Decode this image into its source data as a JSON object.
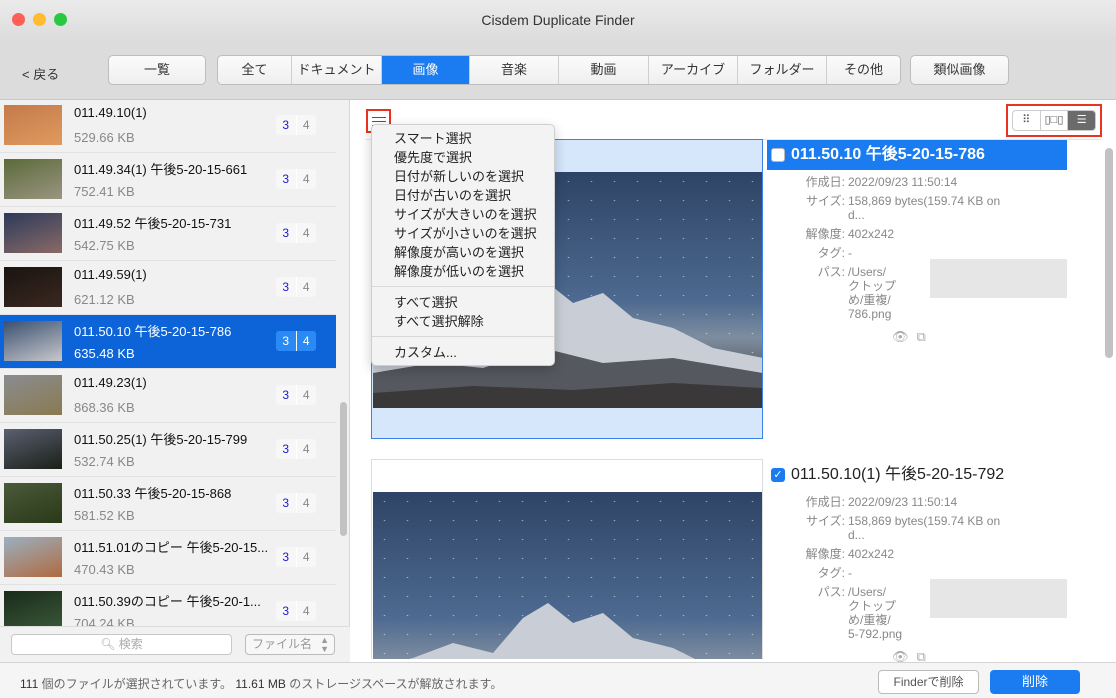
{
  "window": {
    "title": "Cisdem Duplicate Finder"
  },
  "toolbar": {
    "back_label": "< 戻る",
    "overview_label": "一覧",
    "tabs": [
      {
        "label": "全て",
        "active": false
      },
      {
        "label": "ドキュメント",
        "active": false
      },
      {
        "label": "画像",
        "active": true
      },
      {
        "label": "音楽",
        "active": false
      },
      {
        "label": "動画",
        "active": false
      },
      {
        "label": "アーカイブ",
        "active": false
      },
      {
        "label": "フォルダー",
        "active": false
      },
      {
        "label": "その他",
        "active": false
      }
    ],
    "similar_label": "類似画像"
  },
  "sidebar": {
    "items": [
      {
        "name": "011.49.10(1)",
        "size": "529.66 KB",
        "a": "3",
        "b": "4",
        "thumb": [
          "#c47a4a",
          "#e09a5e"
        ]
      },
      {
        "name": "011.49.34(1) 午後5-20-15-661",
        "size": "752.41 KB",
        "a": "3",
        "b": "4",
        "thumb": [
          "#5b6a3a",
          "#9a9580"
        ]
      },
      {
        "name": "011.49.52 午後5-20-15-731",
        "size": "542.75 KB",
        "a": "3",
        "b": "4",
        "thumb": [
          "#2c3a5a",
          "#8a6a66"
        ]
      },
      {
        "name": "011.49.59(1)",
        "size": "621.12 KB",
        "a": "3",
        "b": "4",
        "thumb": [
          "#1a1410",
          "#3a2820"
        ]
      },
      {
        "name": "011.50.10 午後5-20-15-786",
        "size": "635.48 KB",
        "a": "3",
        "b": "4",
        "thumb": [
          "#3a5070",
          "#c8c8cc"
        ],
        "selected": true
      },
      {
        "name": "011.49.23(1)",
        "size": "868.36 KB",
        "a": "3",
        "b": "4",
        "thumb": [
          "#8a8c90",
          "#8a7a50"
        ]
      },
      {
        "name": "011.50.25(1) 午後5-20-15-799",
        "size": "532.74 KB",
        "a": "3",
        "b": "4",
        "thumb": [
          "#5a6070",
          "#1a2018"
        ]
      },
      {
        "name": "011.50.33 午後5-20-15-868",
        "size": "581.52 KB",
        "a": "3",
        "b": "4",
        "thumb": [
          "#4a5a3a",
          "#2a3a18"
        ]
      },
      {
        "name": "011.51.01のコピー 午後5-20-15...",
        "size": "470.43 KB",
        "a": "3",
        "b": "4",
        "thumb": [
          "#9ab0c0",
          "#b06a40"
        ]
      },
      {
        "name": "011.50.39のコピー 午後5-20-1...",
        "size": "704.24 KB",
        "a": "3",
        "b": "4",
        "thumb": [
          "#1a2a1a",
          "#3a5a3a"
        ]
      }
    ],
    "search_placeholder": "検索",
    "search_icon": "magnifier-icon",
    "sort_label": "ファイル名"
  },
  "view_modes": [
    {
      "icon": "grid-view-icon",
      "glyph": "⠿",
      "active": false
    },
    {
      "icon": "filmstrip-view-icon",
      "glyph": "▯□▯",
      "active": false
    },
    {
      "icon": "list-view-icon",
      "glyph": "☰",
      "active": true
    }
  ],
  "select_menu": {
    "items": [
      "スマート選択",
      "優先度で選択",
      "日付が新しいのを選択",
      "日付が古いのを選択",
      "サイズが大きいのを選択",
      "サイズが小さいのを選択",
      "解像度が高いのを選択",
      "解像度が低いのを選択"
    ],
    "items2": [
      "すべて選択",
      "すべて選択解除"
    ],
    "items3": [
      "カスタム..."
    ]
  },
  "files": [
    {
      "title": "011.50.10 午後5-20-15-786",
      "checked": false,
      "selected": true,
      "created_label": "作成日:",
      "created": "2022/09/23 11:50:14",
      "size_label": "サイズ:",
      "size": "158,869 bytes(159.74 KB on d...",
      "res_label": "解像度:",
      "res": "402x242",
      "tag_label": "タグ:",
      "tag": "-",
      "path_label": "パス:",
      "path": [
        "/Users/",
        "クトップ",
        "め/重複/",
        "786.png"
      ]
    },
    {
      "title": "011.50.10(1) 午後5-20-15-792",
      "checked": true,
      "selected": false,
      "created_label": "作成日:",
      "created": "2022/09/23 11:50:14",
      "size_label": "サイズ:",
      "size": "158,869 bytes(159.74 KB on d...",
      "res_label": "解像度:",
      "res": "402x242",
      "tag_label": "タグ:",
      "tag": "-",
      "path_label": "パス:",
      "path": [
        "/Users/",
        "クトップ",
        "め/重複/",
        "5-792.png"
      ]
    }
  ],
  "status": {
    "count": "111",
    "count_text": " 個のファイルが選択されています。 ",
    "size": "11.61 MB",
    "size_text": " のストレージスペースが解放されます。"
  },
  "actions": {
    "finder_delete": "Finderで削除",
    "delete": "削除"
  },
  "colors": {
    "accent": "#1a7cf0",
    "highlight_box": "#e8331e"
  }
}
